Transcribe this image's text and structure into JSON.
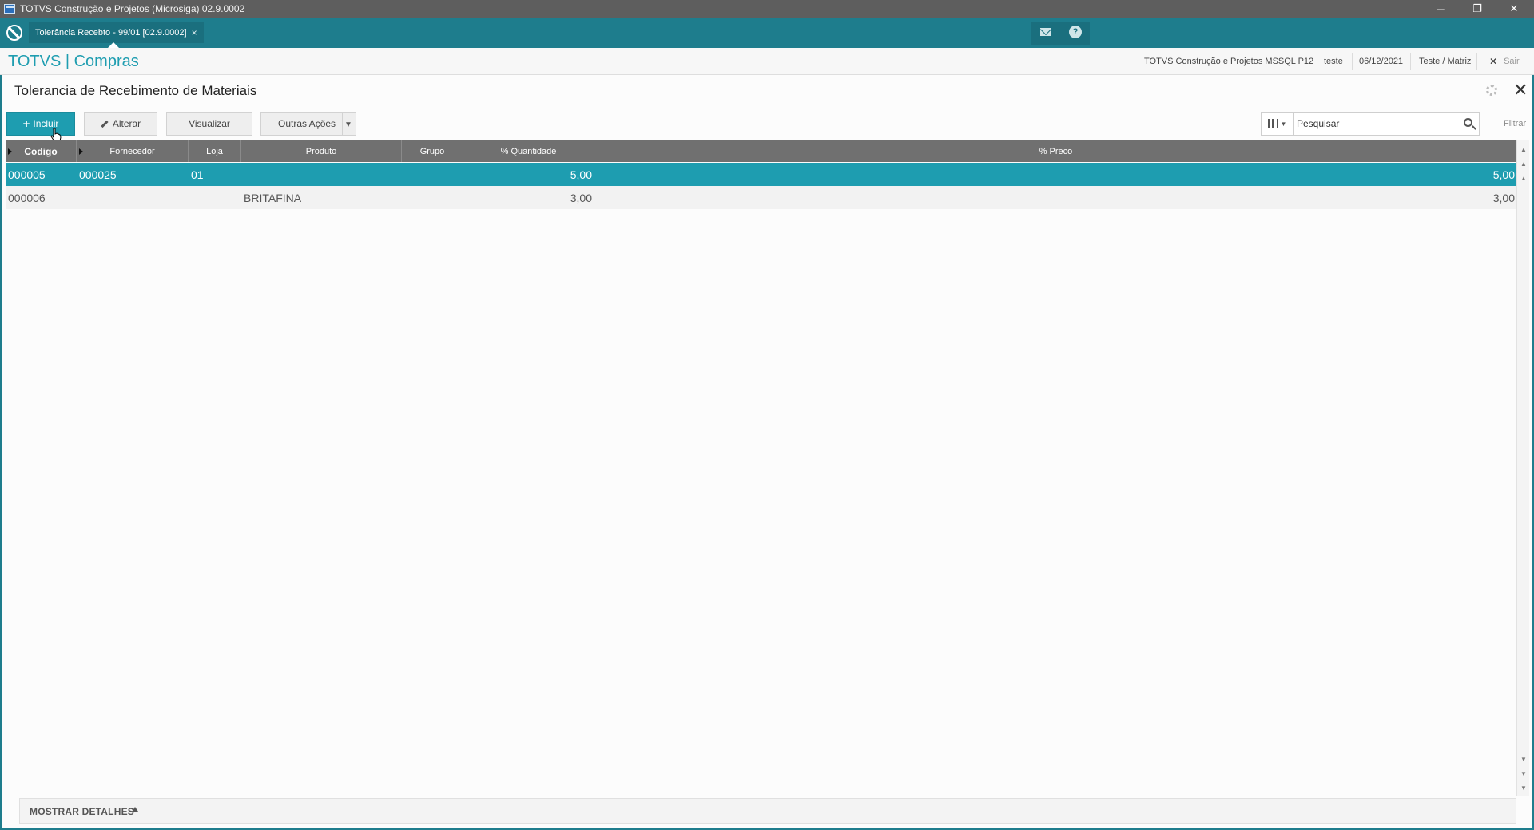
{
  "window": {
    "title": "TOTVS Construção e Projetos (Microsiga) 02.9.0002",
    "minimize": "─",
    "restore": "❐",
    "close": "✕"
  },
  "tabbar": {
    "tab_label": "Tolerância Recebto - 99/01 [02.9.0002]",
    "tab_close": "×",
    "help_glyph": "?"
  },
  "header": {
    "brand": "TOTVS | Compras",
    "environment": "TOTVS Construção e Projetos MSSQL P12",
    "user": "teste",
    "date": "06/12/2021",
    "branch": "Teste / Matriz",
    "exit_label": "Sair",
    "exit_glyph": "✕"
  },
  "page": {
    "title": "Tolerancia de Recebimento de Materiais",
    "close_glyph": "✕"
  },
  "toolbar": {
    "incluir": "Incluir",
    "alterar": "Alterar",
    "visualizar": "Visualizar",
    "outras_acoes": "Outras Ações"
  },
  "search": {
    "value": "Pesquisar",
    "filter_label": "Filtrar"
  },
  "grid": {
    "columns": [
      "Codigo",
      "Fornecedor",
      "Loja",
      "Produto",
      "Grupo",
      "% Quantidade",
      "% Preco"
    ],
    "rows": [
      {
        "codigo": "000005",
        "fornecedor": "000025",
        "loja": "01",
        "produto": "",
        "grupo": "",
        "quantidade": "5,00",
        "preco": "5,00",
        "selected": true
      },
      {
        "codigo": "000006",
        "fornecedor": "",
        "loja": "",
        "produto": "BRITAFINA",
        "grupo": "",
        "quantidade": "3,00",
        "preco": "3,00",
        "selected": false
      }
    ]
  },
  "footer": {
    "details_label": "MOSTRAR DETALHES"
  },
  "colors": {
    "accent": "#1e9db0",
    "tabbar": "#1e7d8d",
    "grid_header": "#707070"
  }
}
